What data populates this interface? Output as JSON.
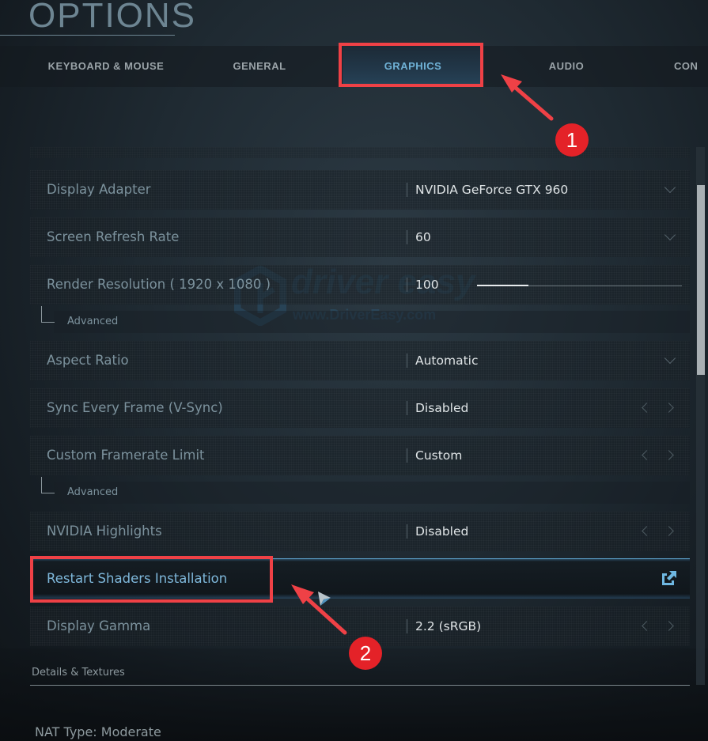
{
  "header": {
    "title": "OPTIONS"
  },
  "tabs": [
    {
      "label": "KEYBOARD & MOUSE",
      "active": false
    },
    {
      "label": "GENERAL",
      "active": false
    },
    {
      "label": "GRAPHICS",
      "active": true
    },
    {
      "label": "AUDIO",
      "active": false
    },
    {
      "label": "CON",
      "active": false
    }
  ],
  "settings": [
    {
      "label": "Display Adapter",
      "value": "NVIDIA GeForce GTX 960",
      "control": "dropdown"
    },
    {
      "label": "Screen Refresh Rate",
      "value": "60",
      "control": "dropdown"
    },
    {
      "label": "Render Resolution ( 1920 x 1080 )",
      "value": "100",
      "control": "slider",
      "slider_fraction": 0.25,
      "sub": "Advanced"
    },
    {
      "label": "Aspect Ratio",
      "value": "Automatic",
      "control": "dropdown"
    },
    {
      "label": "Sync Every Frame (V-Sync)",
      "value": "Disabled",
      "control": "toggle"
    },
    {
      "label": "Custom Framerate Limit",
      "value": "Custom",
      "control": "toggle",
      "sub": "Advanced"
    },
    {
      "label": "NVIDIA Highlights",
      "value": "Disabled",
      "control": "toggle"
    },
    {
      "label": "Restart Shaders Installation",
      "value": "",
      "control": "external"
    },
    {
      "label": "Display Gamma",
      "value": "2.2 (sRGB)",
      "control": "toggle"
    }
  ],
  "section": {
    "title": "Details & Textures"
  },
  "footer": {
    "nat_type": "NAT Type: Moderate"
  },
  "watermark": {
    "brand": "driver easy",
    "url": "www.DriverEasy.com"
  },
  "annotations": {
    "badge1": "1",
    "badge2": "2"
  },
  "colors": {
    "accent": "#6fb1d6",
    "annotation_red": "#ef4146",
    "badge_red": "#e42228"
  }
}
